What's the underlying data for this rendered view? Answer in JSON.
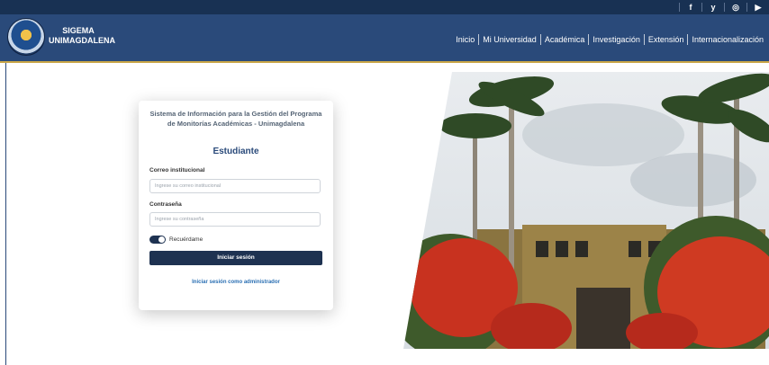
{
  "topbar": {
    "social": [
      {
        "icon": "facebook-icon",
        "glyph": "f"
      },
      {
        "icon": "twitter-icon",
        "glyph": "y"
      },
      {
        "icon": "instagram-icon",
        "glyph": "◎"
      },
      {
        "icon": "youtube-icon",
        "glyph": "▶"
      }
    ]
  },
  "header": {
    "brand_line1": "SIGEMA",
    "brand_line2": "UNIMAGDALENA",
    "menu": [
      "Inicio",
      "Mi Universidad",
      "Académica",
      "Investigación",
      "Extensión",
      "Internacionalización"
    ]
  },
  "login": {
    "system_title": "Sistema de Información para la Gestión del Programa de Monitorías Académicas - Unimagdalena",
    "role": "Estudiante",
    "email_label": "Correo institucional",
    "email_placeholder": "Ingrese su correo institucional",
    "password_label": "Contraseña",
    "password_placeholder": "Ingrese su contraseña",
    "remember_label": "Recuérdame",
    "submit_label": "Iniciar sesión",
    "admin_link": "Iniciar sesión como administrador"
  },
  "colors": {
    "navy": "#183153",
    "header": "#2a4a7a",
    "accent_gold": "#c9a547",
    "button": "#1e3251",
    "link": "#2a6fb3"
  }
}
